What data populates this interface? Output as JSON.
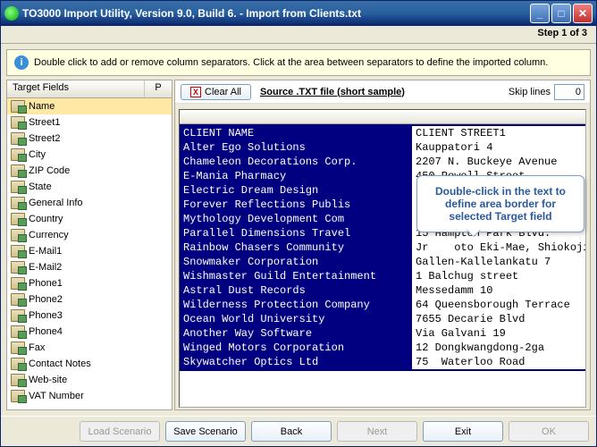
{
  "window": {
    "title": "TO3000 Import Utility, Version 9.0, Build 6.  -  Import from Clients.txt",
    "step_text": "Step 1 of 3"
  },
  "info": {
    "text": "Double click to add or remove column separators. Click at the area between separators to define the imported column."
  },
  "left": {
    "header_fields": "Target Fields",
    "header_p": "P",
    "items": [
      "Name",
      "Street1",
      "Street2",
      "City",
      "ZIP Code",
      "State",
      "General Info",
      "Country",
      "Currency",
      "E-Mail1",
      "E-Mail2",
      "Phone1",
      "Phone2",
      "Phone3",
      "Phone4",
      "Fax",
      "Contact Notes",
      "Web-site",
      "VAT Number"
    ],
    "selected_index": 0
  },
  "right": {
    "clear_all": "Clear All",
    "source_label": "Source .TXT file (short sample)",
    "skip_label": "Skip lines",
    "skip_value": "0"
  },
  "data": {
    "header_a": "CLIENT NAME",
    "header_b": "CLIENT STREET1",
    "rows": [
      {
        "a": "Alter Ego Solutions",
        "b": "Kauppatori 4"
      },
      {
        "a": "Chameleon Decorations Corp.",
        "b": "2207 N. Buckeye Avenue"
      },
      {
        "a": "E-Mania Pharmacy",
        "b": "450 Powell Street"
      },
      {
        "a": "Electric Dream Design",
        "b": ""
      },
      {
        "a": "Forever Reflections Publis",
        "b": ""
      },
      {
        "a": "Mythology Development Com",
        "b": ""
      },
      {
        "a": "Parallel Dimensions Travel",
        "b": "15 Hampton Park Blvd."
      },
      {
        "a": "Rainbow Chasers Community",
        "b": "Jr    oto Eki-Mae, Shiokoji-Dori"
      },
      {
        "a": "Snowmaker Corporation",
        "b": "Gallen-Kallelankatu 7"
      },
      {
        "a": "Wishmaster Guild Entertainment",
        "b": "1 Balchug street"
      },
      {
        "a": "Astral Dust Records",
        "b": "Messedamm 10"
      },
      {
        "a": "Wilderness Protection Company",
        "b": "64 Queensborough Terrace"
      },
      {
        "a": "Ocean World University",
        "b": "7655 Decarie Blvd"
      },
      {
        "a": "Another Way Software",
        "b": "Via Galvani 19"
      },
      {
        "a": "Winged Motors Corporation",
        "b": "12 Dongkwangdong-2ga"
      },
      {
        "a": "Skywatcher Optics Ltd",
        "b": "75  Waterloo Road"
      }
    ]
  },
  "tooltip": {
    "text": "Double-click in the text to define area border for selected Target field"
  },
  "buttons": {
    "load_scenario": "Load Scenario",
    "save_scenario": "Save Scenario",
    "back": "Back",
    "next": "Next",
    "exit": "Exit",
    "ok": "OK"
  }
}
